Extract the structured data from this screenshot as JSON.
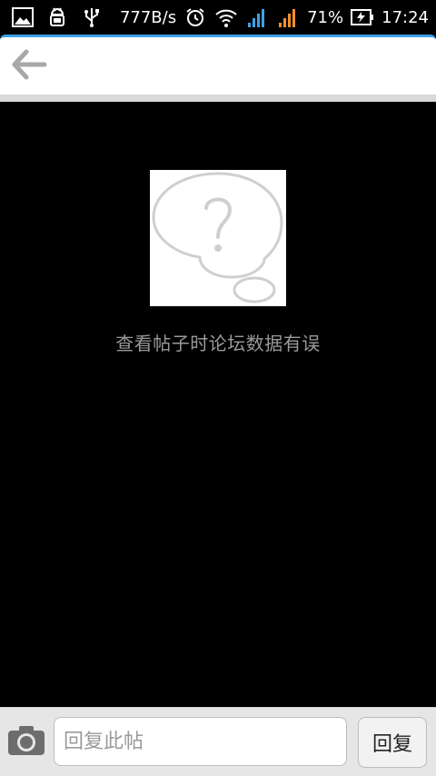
{
  "status_bar": {
    "net_speed": "777B/s",
    "battery_percent": "71%",
    "time": "17:24",
    "icons": [
      "gallery-icon",
      "android-debug-icon",
      "usb-icon",
      "alarm-icon",
      "wifi-icon",
      "signal-blue-icon",
      "signal-orange-icon",
      "battery-charging-icon"
    ]
  },
  "top_bar": {
    "back_icon": "arrow-left-icon"
  },
  "content": {
    "error_icon": "question-bubble-icon",
    "error_message": "查看帖子时论坛数据有误"
  },
  "reply_bar": {
    "camera_icon": "camera-icon",
    "input_placeholder": "回复此帖",
    "input_value": "",
    "reply_button_label": "回复"
  },
  "colors": {
    "accent": "#3ea0e6",
    "background": "#000000",
    "error_text": "#9a9a9a"
  }
}
